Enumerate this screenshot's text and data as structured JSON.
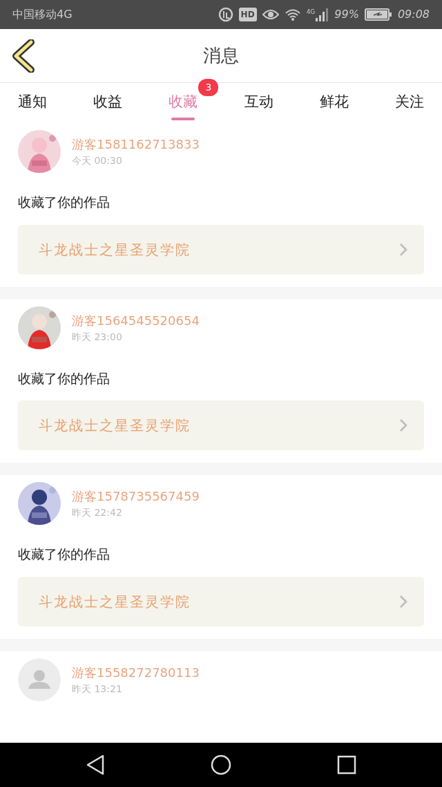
{
  "status_bar": {
    "carrier": "中国移动4G",
    "hd": "HD",
    "network": "4G",
    "battery": "99%",
    "time": "09:08"
  },
  "header": {
    "title": "消息"
  },
  "tabs": [
    {
      "label": "通知",
      "selected": false
    },
    {
      "label": "收益",
      "selected": false
    },
    {
      "label": "收藏",
      "selected": true,
      "badge": "3"
    },
    {
      "label": "互动",
      "selected": false
    },
    {
      "label": "鲜花",
      "selected": false
    },
    {
      "label": "关注",
      "selected": false
    }
  ],
  "messages": [
    {
      "name": "游客1581162713833",
      "time": "今天 00:30",
      "action": "收藏了你的作品",
      "work": "斗龙战士之星圣灵学院"
    },
    {
      "name": "游客1564545520654",
      "time": "昨天 23:00",
      "action": "收藏了你的作品",
      "work": "斗龙战士之星圣灵学院"
    },
    {
      "name": "游客1578735567459",
      "time": "昨天 22:42",
      "action": "收藏了你的作品",
      "work": "斗龙战士之星圣灵学院"
    },
    {
      "avatar": {
        "kind": "default"
      },
      "name": "游客1558272780113",
      "time": "昨天 13:21"
    }
  ]
}
